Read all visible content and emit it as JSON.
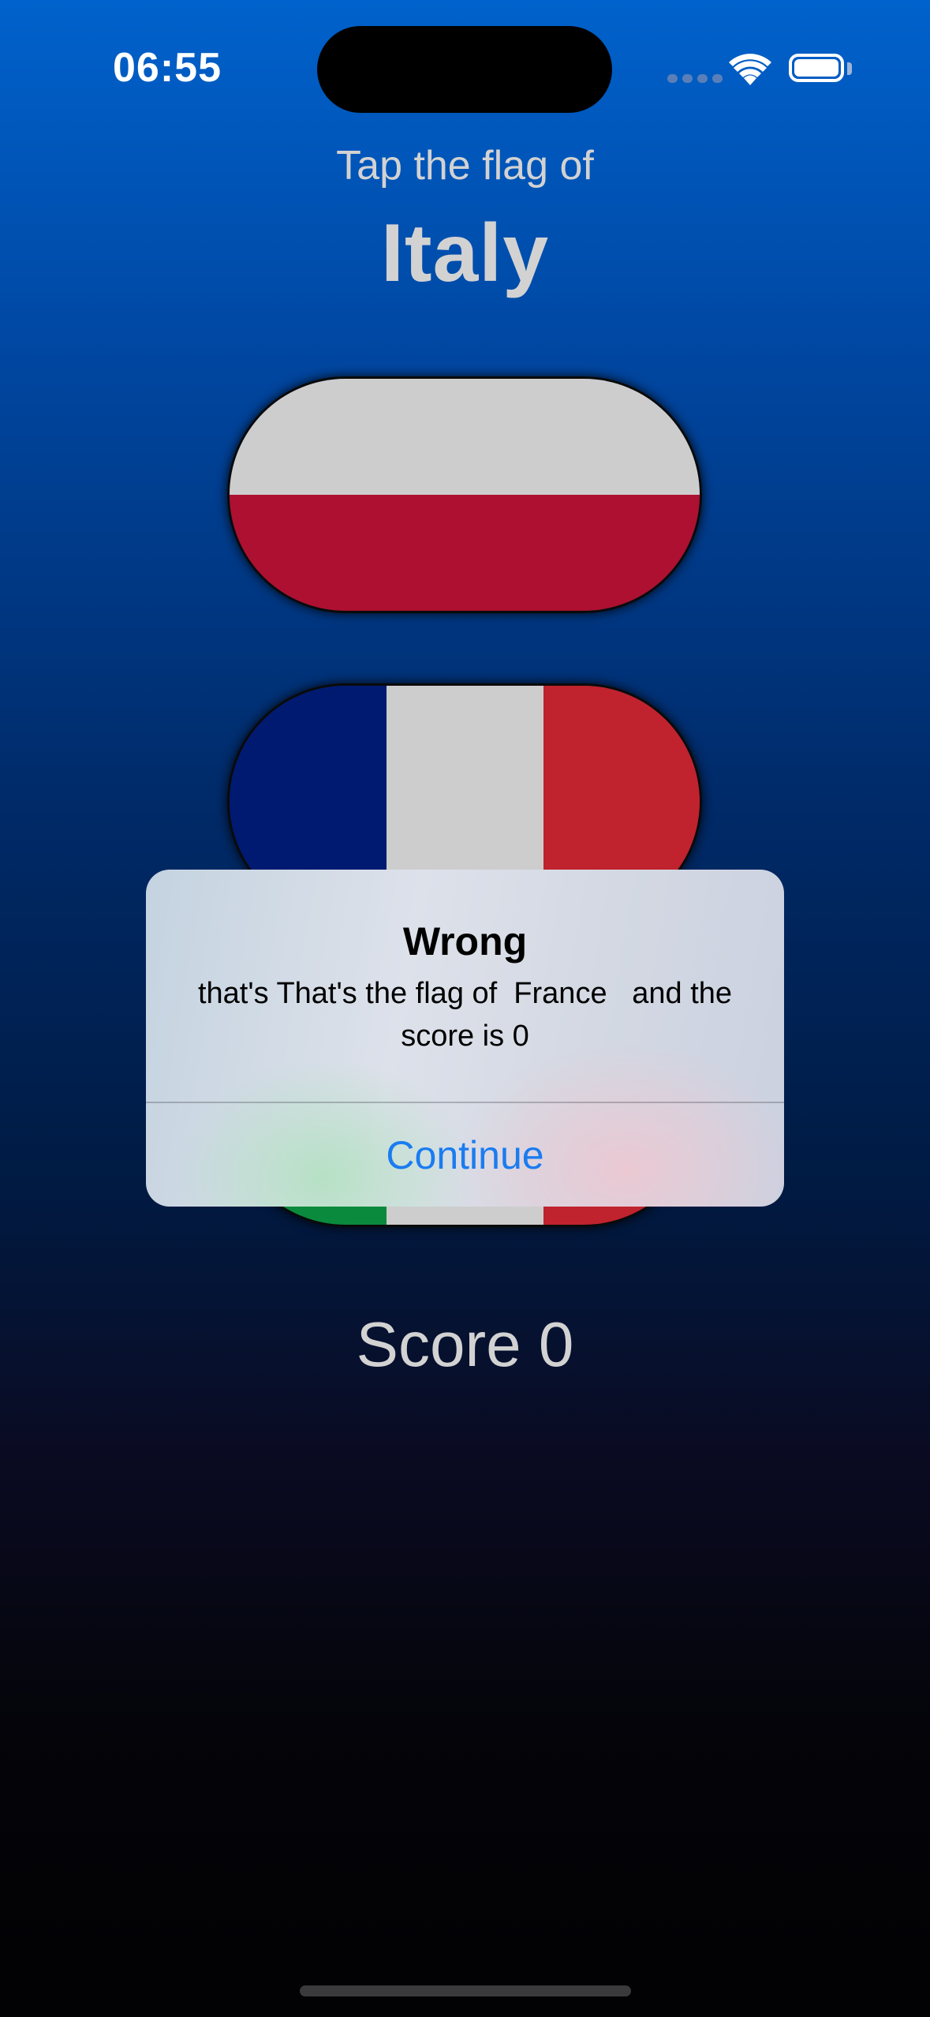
{
  "status_bar": {
    "time": "06:55",
    "icons": [
      "cellular-signal-icon",
      "wifi-icon",
      "battery-icon"
    ]
  },
  "game": {
    "prompt": "Tap the flag of",
    "country": "Italy",
    "score_label": "Score 0"
  },
  "flags": [
    {
      "name": "Poland",
      "orientation": "horizontal",
      "colors": [
        "#cdcdcd",
        "#ad1030"
      ]
    },
    {
      "name": "France",
      "orientation": "vertical",
      "colors": [
        "#001a72",
        "#cdcdcd",
        "#c0222e"
      ]
    },
    {
      "name": "Italy",
      "orientation": "vertical",
      "colors": [
        "#0a8a3c",
        "#cdcdcd",
        "#c0222e"
      ]
    }
  ],
  "alert": {
    "title": "Wrong",
    "message": "that's That's the flag of  France   and the score is 0",
    "button": "Continue"
  },
  "colors": {
    "accent": "#1a7cf0",
    "label": "#d2d2d2"
  }
}
